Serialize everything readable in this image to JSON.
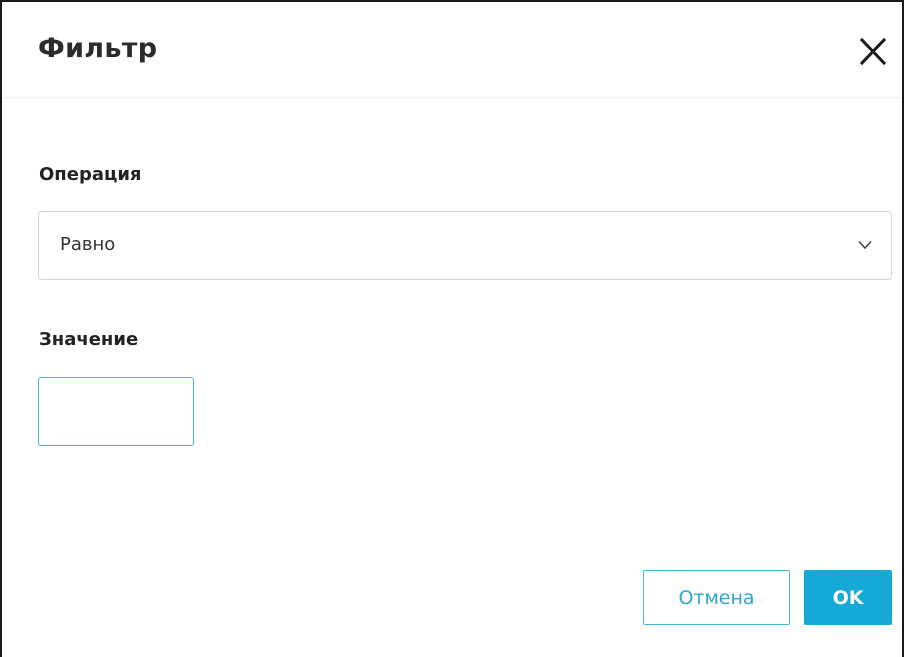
{
  "dialog": {
    "title": "Фильтр",
    "close_icon": "close-icon"
  },
  "operation": {
    "label": "Операция",
    "selected": "Равно",
    "chevron_icon": "chevron-down-icon"
  },
  "value": {
    "label": "Значение",
    "current": ""
  },
  "buttons": {
    "cancel_label": "Отмена",
    "ok_label": "OK"
  },
  "colors": {
    "accent": "#17a9d6",
    "accent_border": "#45b6d6",
    "text": "#222222"
  }
}
